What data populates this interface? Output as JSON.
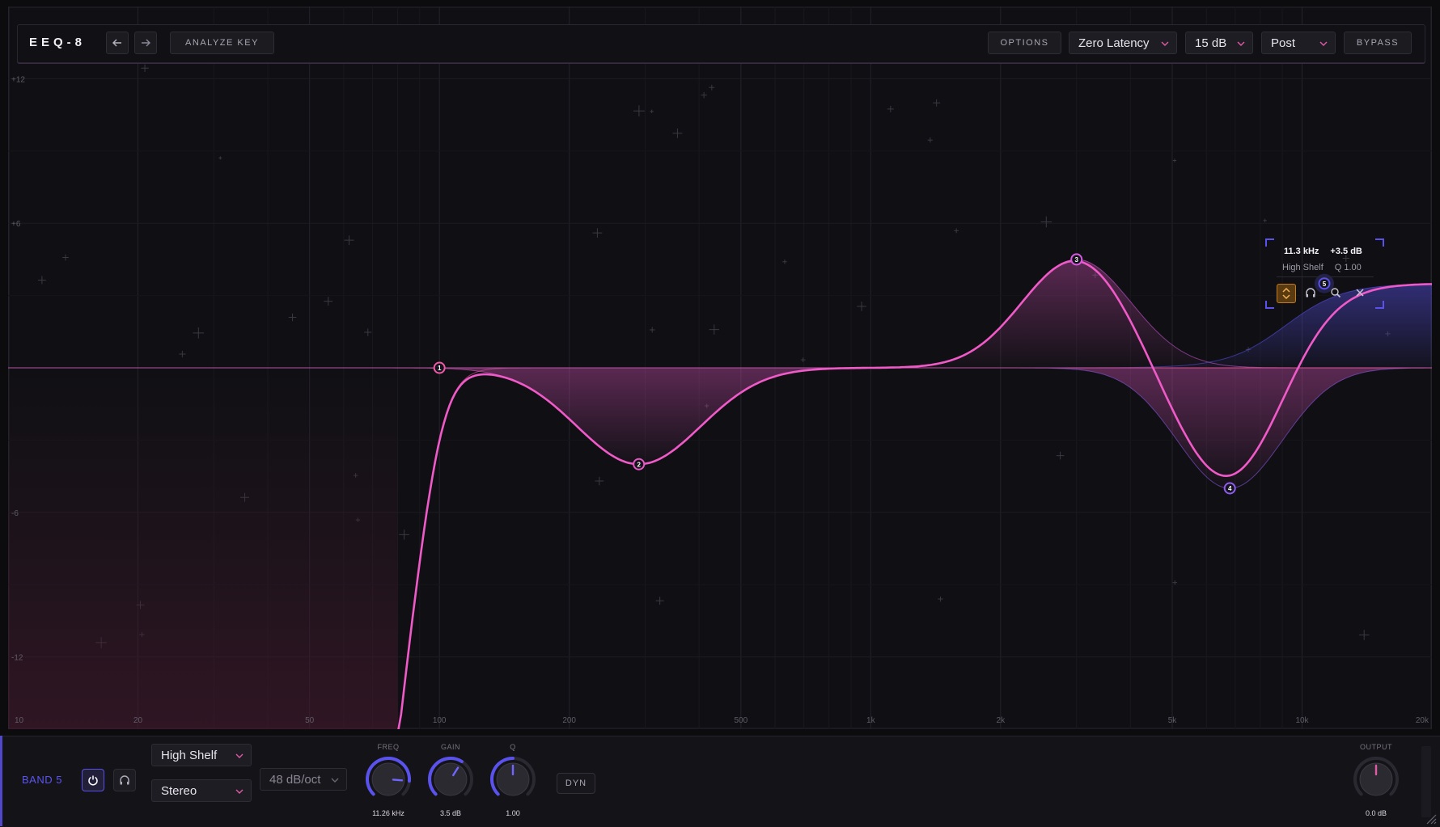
{
  "header": {
    "logo": "EEQ-8",
    "undo_icon": "arrow-left-icon",
    "redo_icon": "arrow-right-icon",
    "analyze_key_label": "ANALYZE KEY",
    "options_label": "OPTIONS",
    "latency_value": "Zero Latency",
    "range_value": "15 dB",
    "mode_value": "Post",
    "bypass_label": "BYPASS"
  },
  "graph": {
    "db_labels": [
      "+12",
      "+6",
      "-6",
      "-12"
    ],
    "freq_labels": [
      "10",
      "20",
      "50",
      "100",
      "200",
      "500",
      "1k",
      "2k",
      "5k",
      "10k",
      "20k"
    ],
    "db_range": [
      -15,
      15
    ],
    "freq_range_hz": [
      10,
      20000
    ],
    "bands": [
      {
        "id": "1",
        "type": "Low Cut",
        "freq_hz": 100,
        "gain_db": 0,
        "slope": "48 dB/oct",
        "color": "#f05aa6"
      },
      {
        "id": "2",
        "type": "Bell",
        "freq_hz": 290,
        "gain_db": -4,
        "q": 1.0,
        "color": "#e657c6"
      },
      {
        "id": "3",
        "type": "Bell",
        "freq_hz": 3000,
        "gain_db": 4.5,
        "q": 1.3,
        "color": "#d65ae0"
      },
      {
        "id": "4",
        "type": "Bell",
        "freq_hz": 6800,
        "gain_db": -5,
        "q": 1.4,
        "color": "#8e5cf0"
      },
      {
        "id": "5",
        "type": "High Shelf",
        "freq_hz": 11260,
        "gain_db": 3.5,
        "q": 1.0,
        "color": "#5a52ec"
      }
    ]
  },
  "tooltip": {
    "freq": "11.3 kHz",
    "gain": "+3.5 dB",
    "type": "High Shelf",
    "q": "Q 1.00",
    "icons": [
      "solo-arrows-icon",
      "headphones-icon",
      "search-icon",
      "close-icon"
    ]
  },
  "band_panel": {
    "band_label": "BAND 5",
    "type_value": "High Shelf",
    "channel_value": "Stereo",
    "slope_value": "48 dB/oct",
    "freq_label": "FREQ",
    "freq_value": "11.26 kHz",
    "freq_position": 0.85,
    "gain_label": "GAIN",
    "gain_value": "3.5 dB",
    "gain_position": 0.62,
    "q_label": "Q",
    "q_value": "1.00",
    "q_position": 0.5,
    "dyn_label": "DYN",
    "output_label": "OUTPUT",
    "output_value": "0.0 dB",
    "output_position": 0.5
  },
  "colors": {
    "accent_blue": "#5a52ec",
    "accent_pink": "#f05aa6",
    "accent_purple": "#b357e0",
    "panel_bg": "#141318"
  }
}
